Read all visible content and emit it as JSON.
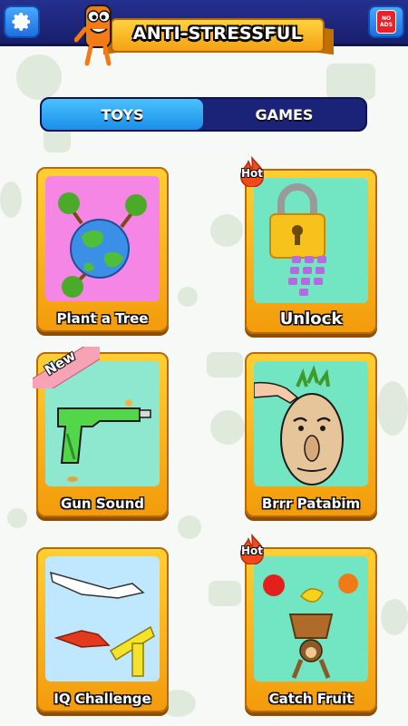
{
  "app": {
    "title": "ANTI-STRESSFUL"
  },
  "topbar": {
    "settings_icon": "gear-icon",
    "noads_icon": "no-ads-icon",
    "noads_text": "NO ADS"
  },
  "tabs": [
    {
      "label": "TOYS",
      "active": true
    },
    {
      "label": "GAMES",
      "active": false
    }
  ],
  "cards": [
    {
      "label": "Plant a Tree",
      "badge": ""
    },
    {
      "label": "Unlock",
      "badge": "Hot"
    },
    {
      "label": "Gun Sound",
      "badge": "New"
    },
    {
      "label": "Brrr Patabim",
      "badge": ""
    },
    {
      "label": "IQ Challenge",
      "badge": ""
    },
    {
      "label": "Catch Fruit",
      "badge": "Hot"
    }
  ],
  "colors": {
    "topbar": "#25308f",
    "tab_active": "#3aaefc",
    "card_frame": "#ffc72c",
    "badge_new": "#f6a3b6",
    "badge_hot": "#f04a1a"
  }
}
